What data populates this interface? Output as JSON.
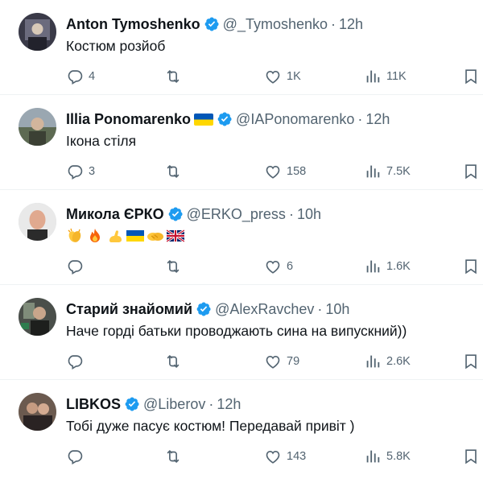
{
  "tweets": [
    {
      "name": "Anton Tymoshenko",
      "handle": "@_Tymoshenko",
      "time": "12h",
      "text": "Костюм розйоб",
      "has_flag": false,
      "replies": "4",
      "retweets": "",
      "likes": "1K",
      "views": "11K"
    },
    {
      "name": "Illia Ponomarenko",
      "handle": "@IAPonomarenko",
      "time": "12h",
      "text": "Ікона стіля",
      "has_flag": true,
      "replies": "3",
      "retweets": "",
      "likes": "158",
      "views": "7.5K"
    },
    {
      "name": "Микола ЄРКО",
      "handle": "@ERKO_press",
      "time": "10h",
      "text": "",
      "emojis": [
        "clapping-hands",
        "fire",
        "flexed-biceps",
        "ukraine-flag",
        "handshake",
        "uk-flag"
      ],
      "has_flag": false,
      "replies": "",
      "retweets": "",
      "likes": "6",
      "views": "1.6K"
    },
    {
      "name": "Старий знайомий",
      "handle": "@AlexRavchev",
      "time": "10h",
      "text": "Наче горді батьки проводжають сина на випускний))",
      "has_flag": false,
      "replies": "",
      "retweets": "",
      "likes": "79",
      "views": "2.6K"
    },
    {
      "name": "LIBKOS",
      "handle": "@Liberov",
      "time": "12h",
      "text": "Тобі дуже пасує костюм! Передавай привіт )",
      "has_flag": false,
      "replies": "",
      "retweets": "",
      "likes": "143",
      "views": "5.8K"
    }
  ],
  "separator_dot": "·",
  "colors": {
    "text": "#0f1419",
    "secondary": "#536471",
    "verified": "#1d9bf0",
    "divider": "#eff3f4"
  },
  "icons": [
    "reply-icon",
    "retweet-icon",
    "like-icon",
    "views-icon",
    "bookmark-icon",
    "verified-badge-icon"
  ]
}
